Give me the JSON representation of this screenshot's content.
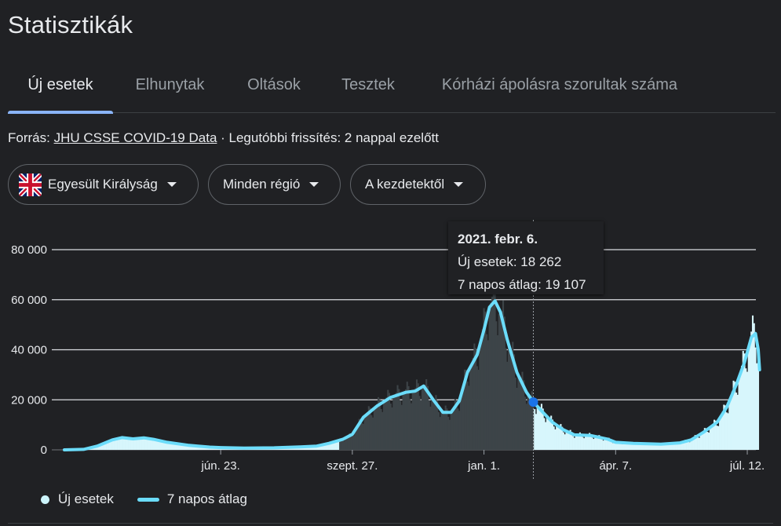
{
  "page_title": "Statisztikák",
  "tabs": [
    {
      "label": "Új esetek",
      "active": true
    },
    {
      "label": "Elhunytak",
      "active": false
    },
    {
      "label": "Oltások",
      "active": false
    },
    {
      "label": "Tesztek",
      "active": false
    },
    {
      "label": "Kórházi ápolásra szorultak száma",
      "active": false
    }
  ],
  "source": {
    "prefix": "Forrás: ",
    "link_text": "JHU CSSE COVID-19 Data",
    "suffix": " · Legutóbbi frissítés: 2 nappal ezelőtt"
  },
  "filters": {
    "country": "Egyesült Királyság",
    "country_icon": "uk-flag-icon",
    "region": "Minden régió",
    "period": "A kezdetektől"
  },
  "tooltip": {
    "date": "2021. febr. 6.",
    "cases": "Új esetek: 18 262",
    "avg": "7 napos átlag: 19 107"
  },
  "legend": {
    "cases": "Új esetek",
    "avg": "7 napos átlag"
  },
  "colors": {
    "avg_line": "#6bdcfa",
    "bars_past": "#3d4448",
    "bars_future": "#d7f6fc",
    "highlight_dot": "#1a73e8",
    "tab_indicator": "#8ab4f8"
  },
  "chart_data": {
    "type": "bar",
    "x_start": "2020-03-01",
    "x_end": "2021-07-20",
    "highlight_date": "2021-02-06",
    "ylim": [
      0,
      80000
    ],
    "y_ticks": [
      0,
      20000,
      40000,
      60000,
      80000
    ],
    "y_tick_labels": [
      "0",
      "20 000",
      "40 000",
      "60 000",
      "80 000"
    ],
    "x_ticks": [
      {
        "date": "2020-06-23",
        "label": "jún. 23."
      },
      {
        "date": "2020-09-27",
        "label": "szept. 27."
      },
      {
        "date": "2021-01-01",
        "label": "jan. 1."
      },
      {
        "date": "2021-04-07",
        "label": "ápr. 7."
      },
      {
        "date": "2021-07-12",
        "label": "júl. 12."
      }
    ],
    "series": [
      {
        "name": "7 napos átlag",
        "points": [
          [
            "2020-03-01",
            0
          ],
          [
            "2020-03-15",
            200
          ],
          [
            "2020-03-25",
            1500
          ],
          [
            "2020-04-05",
            4000
          ],
          [
            "2020-04-12",
            4900
          ],
          [
            "2020-04-20",
            4400
          ],
          [
            "2020-04-28",
            4800
          ],
          [
            "2020-05-05",
            4200
          ],
          [
            "2020-05-15",
            3000
          ],
          [
            "2020-05-31",
            1800
          ],
          [
            "2020-06-15",
            1100
          ],
          [
            "2020-06-23",
            900
          ],
          [
            "2020-07-10",
            700
          ],
          [
            "2020-08-01",
            800
          ],
          [
            "2020-08-20",
            1200
          ],
          [
            "2020-09-01",
            1500
          ],
          [
            "2020-09-10",
            2600
          ],
          [
            "2020-09-20",
            4200
          ],
          [
            "2020-09-27",
            6200
          ],
          [
            "2020-10-05",
            13000
          ],
          [
            "2020-10-15",
            17500
          ],
          [
            "2020-10-25",
            21000
          ],
          [
            "2020-11-05",
            23000
          ],
          [
            "2020-11-12",
            23500
          ],
          [
            "2020-11-18",
            25500
          ],
          [
            "2020-11-25",
            20000
          ],
          [
            "2020-12-02",
            15000
          ],
          [
            "2020-12-08",
            15000
          ],
          [
            "2020-12-14",
            19500
          ],
          [
            "2020-12-20",
            31000
          ],
          [
            "2020-12-27",
            38000
          ],
          [
            "2021-01-01",
            48000
          ],
          [
            "2021-01-05",
            57000
          ],
          [
            "2021-01-09",
            59500
          ],
          [
            "2021-01-13",
            55000
          ],
          [
            "2021-01-18",
            44000
          ],
          [
            "2021-01-25",
            31000
          ],
          [
            "2021-02-01",
            23000
          ],
          [
            "2021-02-06",
            19107
          ],
          [
            "2021-02-13",
            15000
          ],
          [
            "2021-02-20",
            11000
          ],
          [
            "2021-02-28",
            8000
          ],
          [
            "2021-03-08",
            6000
          ],
          [
            "2021-03-20",
            5700
          ],
          [
            "2021-04-01",
            4300
          ],
          [
            "2021-04-07",
            3000
          ],
          [
            "2021-04-20",
            2600
          ],
          [
            "2021-05-10",
            2300
          ],
          [
            "2021-05-24",
            2800
          ],
          [
            "2021-06-01",
            4000
          ],
          [
            "2021-06-10",
            7000
          ],
          [
            "2021-06-20",
            11000
          ],
          [
            "2021-06-27",
            17000
          ],
          [
            "2021-07-04",
            26000
          ],
          [
            "2021-07-10",
            35000
          ],
          [
            "2021-07-15",
            45000
          ],
          [
            "2021-07-18",
            46500
          ],
          [
            "2021-07-20",
            40000
          ],
          [
            "2021-07-21",
            32000
          ]
        ]
      }
    ]
  }
}
